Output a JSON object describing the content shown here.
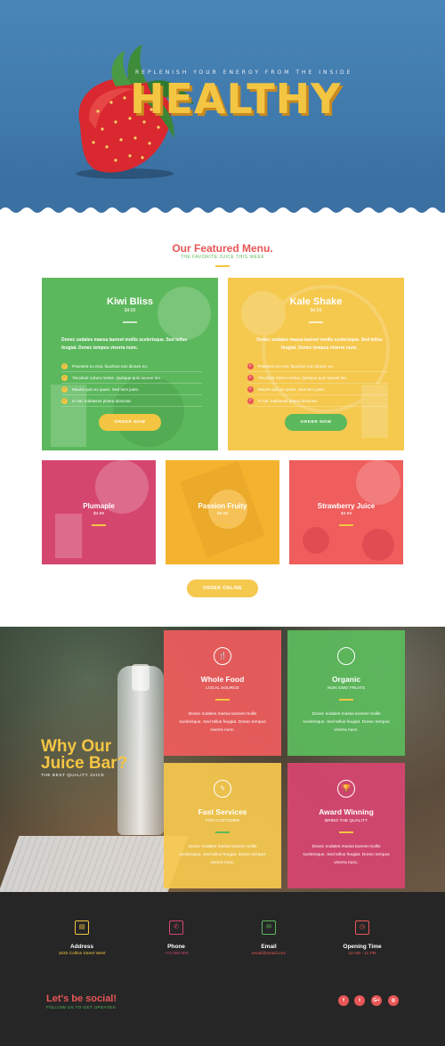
{
  "hero": {
    "tagline": "REPLENISH YOUR ENERGY FROM THE INSIDE",
    "title": "HEALTHY"
  },
  "featured": {
    "title": "Our Featured Menu.",
    "subtitle": "THE FAVORITE JUICE THIS WEEK",
    "big_cards": [
      {
        "name": "Kiwi Bliss",
        "price": "$4.99",
        "description": "Donec sodales massa laoreet mollis scelerisque. Sed tellus feugiat. Donec tempus viverra nunc.",
        "items": [
          "Praesent eu erat, faucibus non dictum eu.",
          "Tincidunt rutrum metus. Quisque quis laoreet leo.",
          "Mauris quis ex quam. Sed sem justo.",
          "In hac habitasse platea dictumst."
        ],
        "button": "ORDER NOW"
      },
      {
        "name": "Kale Shake",
        "price": "$4.99",
        "description": "Donec sodales massa laoreet mollis scelerisque. Sed tellus feugiat. Donec tempus viverra nunc.",
        "items": [
          "Praesent eu erat, faucibus non dictum eu.",
          "Tincidunt rutrum metus. Quisque quis laoreet leo.",
          "Mauris quis ex quam. Sed sem justo.",
          "In hac habitasse platea dictumst."
        ],
        "button": "ORDER NOW"
      }
    ],
    "small_cards": [
      {
        "name": "Plumaple",
        "price": "$4.99"
      },
      {
        "name": "Passion Fruity",
        "price": "$4.99"
      },
      {
        "name": "Strawberry Juice",
        "price": "$4.99"
      }
    ],
    "order_online": "ORDER ONLINE"
  },
  "why": {
    "title_line1": "Why Our",
    "title_line2": "Juice Bar?",
    "subtitle": "THE BEST QUALITY JUICE",
    "features": [
      {
        "title": "Whole Food",
        "sub": "LOCAL SOURCE",
        "desc": "Donec sodales massa laoreet mollis scelerisque. Sed tellus feugiat. Donec tempus viverra nunc.",
        "icon": "utensils-icon"
      },
      {
        "title": "Organic",
        "sub": "NON GMO FRUITS",
        "desc": "Donec sodales massa laoreet mollis scelerisque. Sed tellus feugiat. Donec tempus viverra nunc.",
        "icon": "apple-icon"
      },
      {
        "title": "Fast Services",
        "sub": "FOR CUSTOMER",
        "desc": "Donec sodales massa laoreet mollis scelerisque. Sed tellus feugiat. Donec tempus viverra nunc.",
        "icon": "lightning-icon"
      },
      {
        "title": "Award Winning",
        "sub": "BRING THE QUALITY",
        "desc": "Donec sodales massa laoreet mollis scelerisque. Sed tellus feugiat. Donec tempus viverra nunc.",
        "icon": "trophy-icon"
      }
    ]
  },
  "footer": {
    "contacts": [
      {
        "label": "Address",
        "value": "1632 Collins Street West",
        "icon": "building-icon",
        "color": "#f4c542"
      },
      {
        "label": "Phone",
        "value": "+72 000 000",
        "icon": "phone-icon",
        "color": "#d5466f"
      },
      {
        "label": "Email",
        "value": "email@email.com",
        "icon": "envelope-icon",
        "color": "#5cb85c"
      },
      {
        "label": "Opening Time",
        "value": "10 AM - 11 PM",
        "icon": "clock-icon",
        "color": "#e85656"
      }
    ],
    "social_title": "Let's be social!",
    "social_subtitle": "FOLLOW US TO GET UPDATES",
    "social": [
      {
        "icon": "facebook-icon",
        "glyph": "f"
      },
      {
        "icon": "twitter-icon",
        "glyph": "t"
      },
      {
        "icon": "google-plus-icon",
        "glyph": "G+"
      },
      {
        "icon": "instagram-icon",
        "glyph": "◎"
      }
    ]
  },
  "colors": {
    "green": "#5cb85c",
    "yellow": "#f5c84e",
    "red": "#ef5d5d",
    "pink": "#d5466f",
    "orange": "#f4b32e",
    "dark": "#262626"
  }
}
